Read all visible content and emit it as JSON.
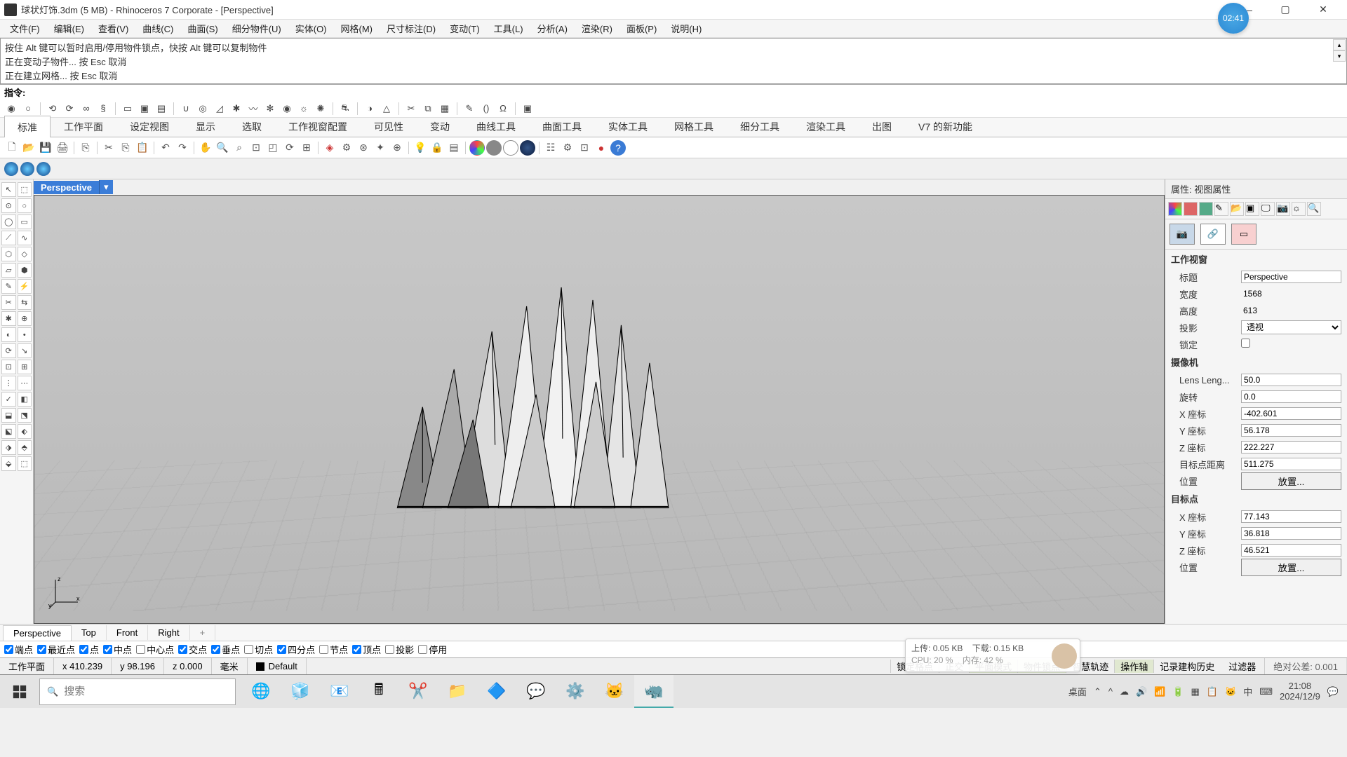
{
  "window": {
    "title": "球状灯饰.3dm (5 MB) - Rhinoceros 7 Corporate - [Perspective]",
    "timer": "02:41"
  },
  "menus": [
    "文件(F)",
    "编辑(E)",
    "查看(V)",
    "曲线(C)",
    "曲面(S)",
    "细分物件(U)",
    "实体(O)",
    "网格(M)",
    "尺寸标注(D)",
    "变动(T)",
    "工具(L)",
    "分析(A)",
    "渲染(R)",
    "面板(P)",
    "说明(H)"
  ],
  "cmd_history": [
    "按住 Alt 键可以暂时启用/停用物件锁点，快按 Alt 键可以复制物件",
    "正在变动子物件... 按 Esc 取消",
    "正在建立网格... 按 Esc 取消"
  ],
  "cmd_prompt": "指令:",
  "tabs": [
    "标准",
    "工作平面",
    "设定视图",
    "显示",
    "选取",
    "工作视窗配置",
    "可见性",
    "变动",
    "曲线工具",
    "曲面工具",
    "实体工具",
    "网格工具",
    "细分工具",
    "渲染工具",
    "出图",
    "V7 的新功能"
  ],
  "viewport": {
    "label": "Perspective"
  },
  "view_tabs": [
    "Perspective",
    "Top",
    "Front",
    "Right"
  ],
  "osnaps": [
    {
      "label": "端点",
      "checked": true
    },
    {
      "label": "最近点",
      "checked": true
    },
    {
      "label": "点",
      "checked": true
    },
    {
      "label": "中点",
      "checked": true
    },
    {
      "label": "中心点",
      "checked": false
    },
    {
      "label": "交点",
      "checked": true
    },
    {
      "label": "垂点",
      "checked": true
    },
    {
      "label": "切点",
      "checked": false
    },
    {
      "label": "四分点",
      "checked": true
    },
    {
      "label": "节点",
      "checked": false
    },
    {
      "label": "顶点",
      "checked": true
    },
    {
      "label": "投影",
      "checked": false
    },
    {
      "label": "停用",
      "checked": false
    }
  ],
  "netmon": {
    "up_label": "上传:",
    "up": "0.05 KB",
    "down_label": "下载:",
    "down": "0.15 KB",
    "cpu_label": "CPU:",
    "cpu": "20 %",
    "mem_label": "内存:",
    "mem": "42 %"
  },
  "status": {
    "cplane": "工作平面",
    "x": "x 410.239",
    "y": "y 98.196",
    "z": "z 0.000",
    "units": "毫米",
    "layer": "Default",
    "toggles": [
      "锁定格点",
      "正交",
      "平面模式",
      "物件锁点",
      "智慧轨迹",
      "操作轴",
      "记录建构历史"
    ],
    "active_toggles": [
      "平面模式",
      "物件锁点",
      "操作轴"
    ],
    "filter": "过滤器",
    "tol": "绝对公差: 0.001"
  },
  "properties": {
    "header": "属性: 视图属性",
    "section_viewport": "工作视窗",
    "rows_viewport": [
      {
        "label": "标题",
        "value": "Perspective",
        "type": "text"
      },
      {
        "label": "宽度",
        "value": "1568",
        "type": "ro"
      },
      {
        "label": "高度",
        "value": "613",
        "type": "ro"
      },
      {
        "label": "投影",
        "value": "透视",
        "type": "select"
      },
      {
        "label": "锁定",
        "value": "",
        "type": "check"
      }
    ],
    "section_camera": "摄像机",
    "rows_camera": [
      {
        "label": "Lens Leng...",
        "value": "50.0",
        "type": "text"
      },
      {
        "label": "旋转",
        "value": "0.0",
        "type": "text"
      },
      {
        "label": "X 座标",
        "value": "-402.601",
        "type": "text"
      },
      {
        "label": "Y 座标",
        "value": "56.178",
        "type": "text"
      },
      {
        "label": "Z 座标",
        "value": "222.227",
        "type": "text"
      },
      {
        "label": "目标点距离",
        "value": "511.275",
        "type": "text"
      },
      {
        "label": "位置",
        "value": "放置...",
        "type": "button"
      }
    ],
    "section_target": "目标点",
    "rows_target": [
      {
        "label": "X 座标",
        "value": "77.143",
        "type": "text"
      },
      {
        "label": "Y 座标",
        "value": "36.818",
        "type": "text"
      },
      {
        "label": "Z 座标",
        "value": "46.521",
        "type": "text"
      },
      {
        "label": "位置",
        "value": "放置...",
        "type": "button"
      }
    ]
  },
  "taskbar": {
    "search_placeholder": "搜索",
    "desktop": "桌面",
    "time": "21:08",
    "date": "2024/12/9"
  }
}
